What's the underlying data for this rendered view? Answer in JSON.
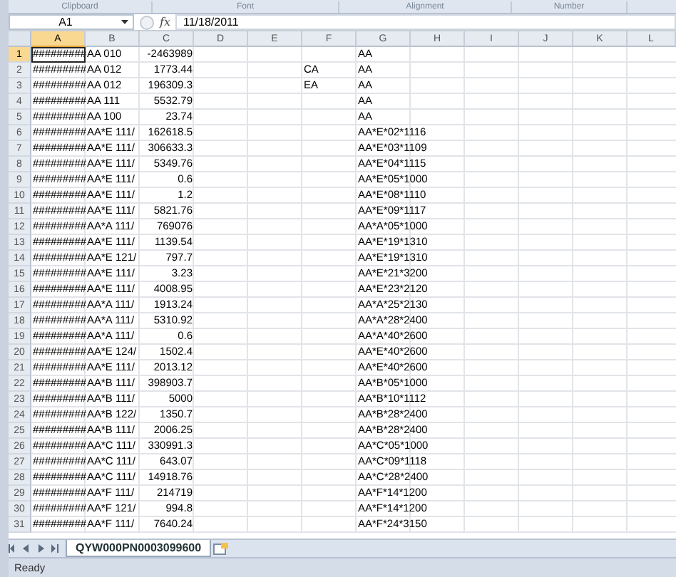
{
  "ribbon_groups": [
    "Clipboard",
    "Font",
    "Alignment",
    "Number"
  ],
  "formula_bar": {
    "name_box": "A1",
    "function_label": "fx",
    "value": "11/18/2011"
  },
  "columns": [
    {
      "label": "A",
      "selected": true
    },
    {
      "label": "B",
      "selected": false
    },
    {
      "label": "C",
      "selected": false
    },
    {
      "label": "D",
      "selected": false
    },
    {
      "label": "E",
      "selected": false
    },
    {
      "label": "F",
      "selected": false
    },
    {
      "label": "G",
      "selected": false
    },
    {
      "label": "H",
      "selected": false
    },
    {
      "label": "I",
      "selected": false
    },
    {
      "label": "J",
      "selected": false
    },
    {
      "label": "K",
      "selected": false
    },
    {
      "label": "L",
      "selected": false
    }
  ],
  "rows": [
    {
      "number": "1",
      "selected": true,
      "a": "#########",
      "b": "AA 010",
      "c": "-2463989",
      "g": "AA"
    },
    {
      "number": "2",
      "selected": false,
      "a": "#########",
      "b": "AA 012",
      "c": "1773.44",
      "f": "CA",
      "g": "AA"
    },
    {
      "number": "3",
      "selected": false,
      "a": "#########",
      "b": "AA 012",
      "c": "196309.3",
      "f": "EA",
      "g": "AA"
    },
    {
      "number": "4",
      "selected": false,
      "a": "#########",
      "b": "AA 111",
      "c": "5532.79",
      "g": "AA"
    },
    {
      "number": "5",
      "selected": false,
      "a": "#########",
      "b": "AA 100",
      "c": "23.74",
      "g": "AA"
    },
    {
      "number": "6",
      "selected": false,
      "a": "#########",
      "b": "AA*E 111/",
      "c": "162618.5",
      "g": "AA*E*02*1116"
    },
    {
      "number": "7",
      "selected": false,
      "a": "#########",
      "b": "AA*E 111/",
      "c": "306633.3",
      "g": "AA*E*03*1109"
    },
    {
      "number": "8",
      "selected": false,
      "a": "#########",
      "b": "AA*E 111/",
      "c": "5349.76",
      "g": "AA*E*04*1115"
    },
    {
      "number": "9",
      "selected": false,
      "a": "#########",
      "b": "AA*E 111/",
      "c": "0.6",
      "g": "AA*E*05*1000"
    },
    {
      "number": "10",
      "selected": false,
      "a": "#########",
      "b": "AA*E 111/",
      "c": "1.2",
      "g": "AA*E*08*1110"
    },
    {
      "number": "11",
      "selected": false,
      "a": "#########",
      "b": "AA*E 111/",
      "c": "5821.76",
      "g": "AA*E*09*1117"
    },
    {
      "number": "12",
      "selected": false,
      "a": "#########",
      "b": "AA*A 111/",
      "c": "769076",
      "g": "AA*A*05*1000"
    },
    {
      "number": "13",
      "selected": false,
      "a": "#########",
      "b": "AA*E 111/",
      "c": "1139.54",
      "g": "AA*E*19*1310"
    },
    {
      "number": "14",
      "selected": false,
      "a": "#########",
      "b": "AA*E 121/",
      "c": "797.7",
      "g": "AA*E*19*1310"
    },
    {
      "number": "15",
      "selected": false,
      "a": "#########",
      "b": "AA*E 111/",
      "c": "3.23",
      "g": "AA*E*21*3200"
    },
    {
      "number": "16",
      "selected": false,
      "a": "#########",
      "b": "AA*E 111/",
      "c": "4008.95",
      "g": "AA*E*23*2120"
    },
    {
      "number": "17",
      "selected": false,
      "a": "#########",
      "b": "AA*A 111/",
      "c": "1913.24",
      "g": "AA*A*25*2130"
    },
    {
      "number": "18",
      "selected": false,
      "a": "#########",
      "b": "AA*A 111/",
      "c": "5310.92",
      "g": "AA*A*28*2400"
    },
    {
      "number": "19",
      "selected": false,
      "a": "#########",
      "b": "AA*A 111/",
      "c": "0.6",
      "g": "AA*A*40*2600"
    },
    {
      "number": "20",
      "selected": false,
      "a": "#########",
      "b": "AA*E 124/",
      "c": "1502.4",
      "g": "AA*E*40*2600"
    },
    {
      "number": "21",
      "selected": false,
      "a": "#########",
      "b": "AA*E 111/",
      "c": "2013.12",
      "g": "AA*E*40*2600"
    },
    {
      "number": "22",
      "selected": false,
      "a": "#########",
      "b": "AA*B 111/",
      "c": "398903.7",
      "g": "AA*B*05*1000"
    },
    {
      "number": "23",
      "selected": false,
      "a": "#########",
      "b": "AA*B 111/",
      "c": "5000",
      "g": "AA*B*10*1112"
    },
    {
      "number": "24",
      "selected": false,
      "a": "#########",
      "b": "AA*B 122/",
      "c": "1350.7",
      "g": "AA*B*28*2400"
    },
    {
      "number": "25",
      "selected": false,
      "a": "#########",
      "b": "AA*B 111/",
      "c": "2006.25",
      "g": "AA*B*28*2400"
    },
    {
      "number": "26",
      "selected": false,
      "a": "#########",
      "b": "AA*C 111/",
      "c": "330991.3",
      "g": "AA*C*05*1000"
    },
    {
      "number": "27",
      "selected": false,
      "a": "#########",
      "b": "AA*C 111/",
      "c": "643.07",
      "g": "AA*C*09*1118"
    },
    {
      "number": "28",
      "selected": false,
      "a": "#########",
      "b": "AA*C 111/",
      "c": "14918.76",
      "g": "AA*C*28*2400"
    },
    {
      "number": "29",
      "selected": false,
      "a": "#########",
      "b": "AA*F 111/",
      "c": "214719",
      "g": "AA*F*14*1200"
    },
    {
      "number": "30",
      "selected": false,
      "a": "#########",
      "b": "AA*F 121/",
      "c": "994.8",
      "g": "AA*F*14*1200"
    },
    {
      "number": "31",
      "selected": false,
      "a": "#########",
      "b": "AA*F 111/",
      "c": "7640.24",
      "g": "AA*F*24*3150"
    }
  ],
  "sheet_tabs": [
    {
      "label": "QYW000PN0003099600",
      "selected": true
    }
  ],
  "status_bar": {
    "text": "Ready"
  }
}
